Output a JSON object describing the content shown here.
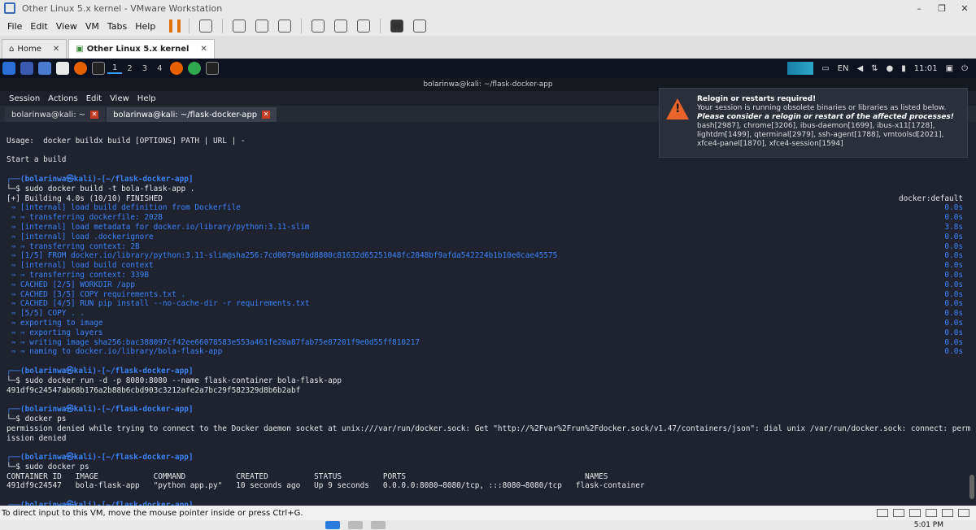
{
  "vmware": {
    "title": "Other Linux 5.x kernel - VMware Workstation",
    "menu": [
      "File",
      "Edit",
      "View",
      "VM",
      "Tabs",
      "Help"
    ],
    "tabs": [
      {
        "label": "Home"
      },
      {
        "label": "Other Linux 5.x kernel"
      }
    ],
    "status_text": "To direct input to this VM, move the mouse pointer inside or press Ctrl+G."
  },
  "panel": {
    "workspaces": [
      "1",
      "2",
      "3",
      "4"
    ],
    "lang": "EN",
    "time": "11:01"
  },
  "terminal": {
    "title": "bolarinwa@kali: ~/flask-docker-app",
    "menu": [
      "Session",
      "Actions",
      "Edit",
      "View",
      "Help"
    ],
    "tabs": [
      {
        "label": "bolarinwa@kali: ~"
      },
      {
        "label": "bolarinwa@kali: ~/flask-docker-app"
      }
    ],
    "lines": [
      {
        "text": "",
        "cls": ""
      },
      {
        "text": "Usage:  docker buildx build [OPTIONS] PATH | URL | -",
        "cls": ""
      },
      {
        "text": "",
        "cls": ""
      },
      {
        "text": "Start a build",
        "cls": ""
      },
      {
        "text": "",
        "cls": ""
      },
      {
        "text": "┌──(bolarinwa㉿kali)-[~/flask-docker-app]",
        "cls": "blue bold"
      },
      {
        "text": "└─$ sudo docker build -t bola-flask-app .",
        "cls": ""
      },
      {
        "text": "[+] Building 4.0s (10/10) FINISHED",
        "cls": "",
        "right": "docker:default"
      },
      {
        "text": " ⇒ [internal] load build definition from Dockerfile",
        "cls": "blue",
        "right": "0.0s"
      },
      {
        "text": " ⇒ ⇒ transferring dockerfile: 202B",
        "cls": "blue",
        "right": "0.0s"
      },
      {
        "text": " ⇒ [internal] load metadata for docker.io/library/python:3.11-slim",
        "cls": "blue",
        "right": "3.8s"
      },
      {
        "text": " ⇒ [internal] load .dockerignore",
        "cls": "blue",
        "right": "0.0s"
      },
      {
        "text": " ⇒ ⇒ transferring context: 2B",
        "cls": "blue",
        "right": "0.0s"
      },
      {
        "text": " ⇒ [1/5] FROM docker.io/library/python:3.11-slim@sha256:7cd0079a9bd8800c81632d65251048fc2848bf9afda542224b1b10e0cae45575",
        "cls": "blue",
        "right": "0.0s"
      },
      {
        "text": " ⇒ [internal] load build context",
        "cls": "blue",
        "right": "0.0s"
      },
      {
        "text": " ⇒ ⇒ transferring context: 339B",
        "cls": "blue",
        "right": "0.0s"
      },
      {
        "text": " ⇒ CACHED [2/5] WORKDIR /app",
        "cls": "blue",
        "right": "0.0s"
      },
      {
        "text": " ⇒ CACHED [3/5] COPY requirements.txt .",
        "cls": "blue",
        "right": "0.0s"
      },
      {
        "text": " ⇒ CACHED [4/5] RUN pip install --no-cache-dir -r requirements.txt",
        "cls": "blue",
        "right": "0.0s"
      },
      {
        "text": " ⇒ [5/5] COPY . .",
        "cls": "blue",
        "right": "0.0s"
      },
      {
        "text": " ⇒ exporting to image",
        "cls": "blue",
        "right": "0.0s"
      },
      {
        "text": " ⇒ ⇒ exporting layers",
        "cls": "blue",
        "right": "0.0s"
      },
      {
        "text": " ⇒ ⇒ writing image sha256:bac388097cf42ee66078583e553a461fe20a87fab75e87201f9e0d55ff810217",
        "cls": "blue",
        "right": "0.0s"
      },
      {
        "text": " ⇒ ⇒ naming to docker.io/library/bola-flask-app",
        "cls": "blue",
        "right": "0.0s"
      },
      {
        "text": "",
        "cls": ""
      },
      {
        "text": "┌──(bolarinwa㉿kali)-[~/flask-docker-app]",
        "cls": "blue bold"
      },
      {
        "text": "└─$ sudo docker run -d -p 8080:8080 --name flask-container bola-flask-app",
        "cls": ""
      },
      {
        "text": "491df9c24547ab68b176a2b88b6cbd903c3212afe2a7bc29f582329d8b6b2abf",
        "cls": ""
      },
      {
        "text": "",
        "cls": ""
      },
      {
        "text": "┌──(bolarinwa㉿kali)-[~/flask-docker-app]",
        "cls": "blue bold"
      },
      {
        "text": "└─$ docker ps",
        "cls": ""
      },
      {
        "text": "permission denied while trying to connect to the Docker daemon socket at unix:///var/run/docker.sock: Get \"http://%2Fvar%2Frun%2Fdocker.sock/v1.47/containers/json\": dial unix /var/run/docker.sock: connect: perm",
        "cls": ""
      },
      {
        "text": "ission denied",
        "cls": ""
      },
      {
        "text": "",
        "cls": ""
      },
      {
        "text": "┌──(bolarinwa㉿kali)-[~/flask-docker-app]",
        "cls": "blue bold"
      },
      {
        "text": "└─$ sudo docker ps",
        "cls": ""
      },
      {
        "text": "CONTAINER ID   IMAGE            COMMAND           CREATED          STATUS         PORTS                                       NAMES",
        "cls": ""
      },
      {
        "text": "491df9c24547   bola-flask-app   \"python app.py\"   10 seconds ago   Up 9 seconds   0.0.0.0:8080→8080/tcp, :::8080→8080/tcp   flask-container",
        "cls": ""
      },
      {
        "text": "",
        "cls": ""
      },
      {
        "text": "┌──(bolarinwa㉿kali)-[~/flask-docker-app]",
        "cls": "blue bold"
      }
    ]
  },
  "notification": {
    "title": "Relogin or restarts required!",
    "line1": "Your session is running obsolete binaries or libraries as listed below.",
    "line2": "Please consider a relogin or restart of the affected processes!",
    "line3": "bash[2987], chrome[3206], ibus-daemon[1699], ibus-x11[1728], lightdm[1499], qterminal[2979], ssh-agent[1788], vmtoolsd[2021], xfce4-panel[1870], xfce4-session[1594]"
  },
  "taskbar": {
    "time": "5:01 PM"
  }
}
